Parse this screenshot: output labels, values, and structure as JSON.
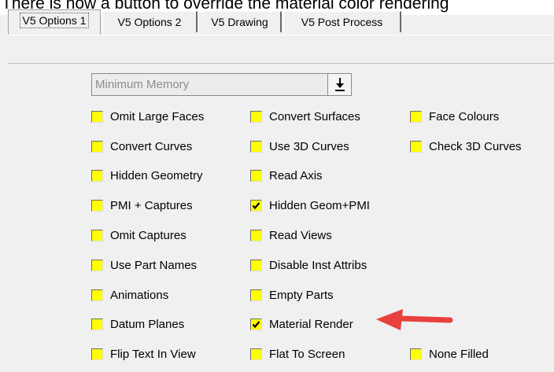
{
  "caption": "There is now a button to override the material color rendering",
  "tabs": [
    {
      "label": "V5 Options 1",
      "active": true
    },
    {
      "label": "V5 Options 2",
      "active": false
    },
    {
      "label": "V5 Drawing",
      "active": false
    },
    {
      "label": "V5 Post Process",
      "active": false
    }
  ],
  "memory_select": {
    "value": "Minimum Memory",
    "icon": "download-arrow-icon"
  },
  "options": {
    "col1": [
      {
        "label": "Omit Large Faces",
        "checked": false
      },
      {
        "label": "Convert Curves",
        "checked": false
      },
      {
        "label": "Hidden Geometry",
        "checked": false
      },
      {
        "label": "PMI + Captures",
        "checked": false
      },
      {
        "label": "Omit Captures",
        "checked": false
      },
      {
        "label": "Use Part Names",
        "checked": false
      },
      {
        "label": "Animations",
        "checked": false
      },
      {
        "label": "Datum Planes",
        "checked": false
      },
      {
        "label": "Flip Text In View",
        "checked": false
      }
    ],
    "col2": [
      {
        "label": "Convert Surfaces",
        "checked": false
      },
      {
        "label": "Use 3D Curves",
        "checked": false
      },
      {
        "label": "Read Axis",
        "checked": false
      },
      {
        "label": "Hidden Geom+PMI",
        "checked": true
      },
      {
        "label": "Read Views",
        "checked": false
      },
      {
        "label": "Disable Inst Attribs",
        "checked": false
      },
      {
        "label": "Empty Parts",
        "checked": false
      },
      {
        "label": "Material Render",
        "checked": true
      },
      {
        "label": "Flat To Screen",
        "checked": false
      }
    ],
    "col3": [
      {
        "label": "Face Colours",
        "checked": false
      },
      {
        "label": "Check 3D Curves",
        "checked": false
      },
      {
        "label": "None Filled",
        "checked": false
      }
    ]
  },
  "colors": {
    "checkbox_fill": "#ffff00",
    "arrow": "#e8403f"
  }
}
